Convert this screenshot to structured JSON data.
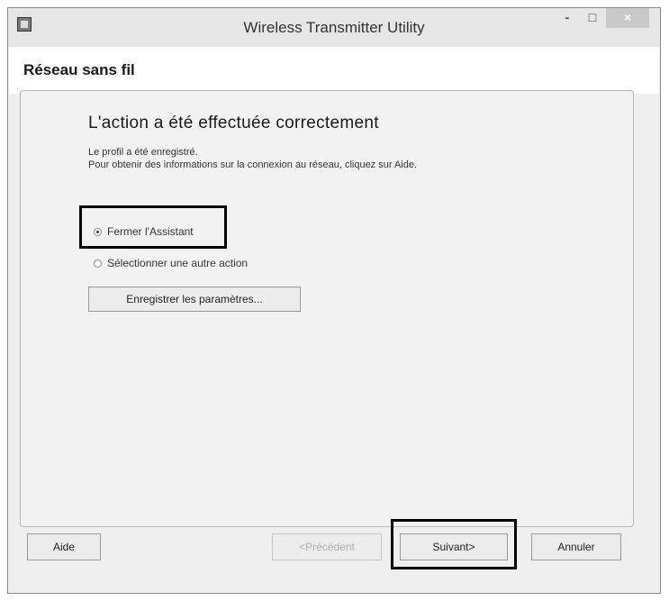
{
  "window": {
    "title": "Wireless Transmitter Utility",
    "minimize_glyph": "-",
    "maximize_glyph": "□",
    "close_glyph": "×",
    "app_icon": "app-window-icon"
  },
  "header": {
    "section_title": "Réseau sans fil"
  },
  "content": {
    "headline": "L'action a été effectuée correctement",
    "desc_line1": "Le profil a été enregistré.",
    "desc_line2": "Pour obtenir des informations sur la connexion au réseau, cliquez sur Aide.",
    "options": [
      {
        "label": "Fermer l'Assistant",
        "selected": true
      },
      {
        "label": "Sélectionner une autre action",
        "selected": false
      }
    ],
    "save_button": "Enregistrer les paramètres..."
  },
  "footer": {
    "help": "Aide",
    "prev": "<Précédent",
    "next": "Suivant>",
    "cancel": "Annuler"
  },
  "colors": {
    "window_bg": "#efefef",
    "highlight_border": "#000000",
    "disabled_text": "#b0b0b0"
  }
}
